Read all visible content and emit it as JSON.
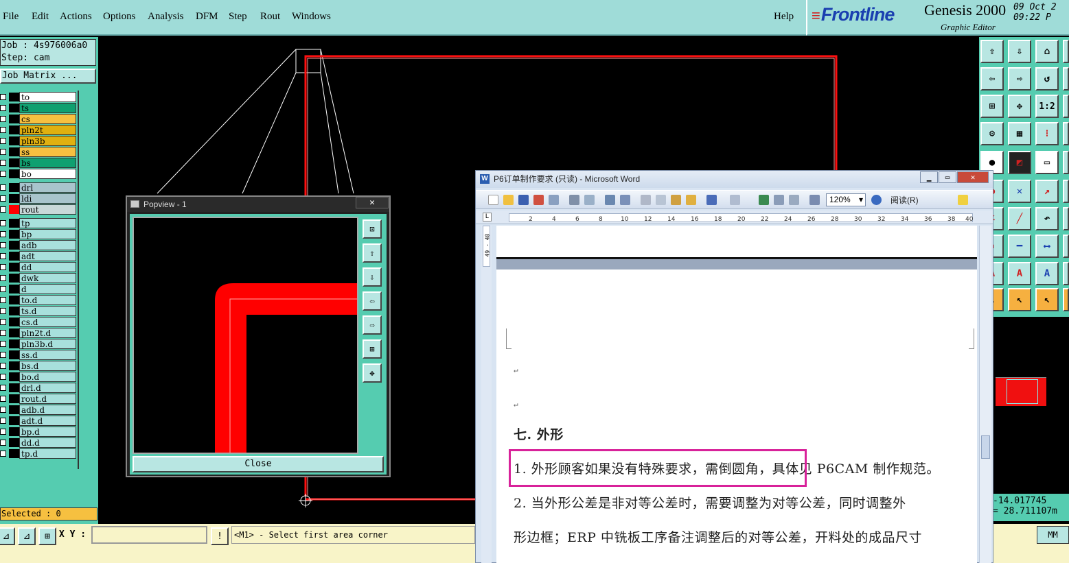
{
  "menubar": {
    "items": [
      "File",
      "Edit",
      "Actions",
      "Options",
      "Analysis",
      "DFM",
      "Step",
      "Rout",
      "Windows"
    ],
    "help": "Help"
  },
  "brand": {
    "logo": "Frontline",
    "product": "Genesis 2000",
    "subtitle": "Graphic Editor",
    "date": "09 Oct 2",
    "time": "09:22 P"
  },
  "left": {
    "job": "Job : 4s976006a0",
    "step": "Step: cam",
    "matrix_button": "Job Matrix ...",
    "selected": "Selected : 0",
    "layers": [
      {
        "name": "to",
        "color": "#ffffff",
        "swatch": "#000000"
      },
      {
        "name": "ts",
        "color": "#10a070",
        "swatch": "#000000"
      },
      {
        "name": "cs",
        "color": "#f6c040",
        "swatch": "#000000"
      },
      {
        "name": "pln2t",
        "color": "#e0b010",
        "swatch": "#000000"
      },
      {
        "name": "pln3b",
        "color": "#e0b010",
        "swatch": "#000000"
      },
      {
        "name": "ss",
        "color": "#f6c040",
        "swatch": "#000000"
      },
      {
        "name": "bs",
        "color": "#10a070",
        "swatch": "#000000"
      },
      {
        "name": "bo",
        "color": "#ffffff",
        "swatch": "#000000"
      },
      {
        "name": "drl",
        "color": "#a8c4cc",
        "swatch": "#000000"
      },
      {
        "name": "ldi",
        "color": "#a8c4cc",
        "swatch": "#000000"
      },
      {
        "name": "rout",
        "color": "#c8d8d8",
        "swatch": "#ff0000"
      },
      {
        "name": "tp",
        "color": "#a8e0dc",
        "swatch": "#000000"
      },
      {
        "name": "bp",
        "color": "#a8e0dc",
        "swatch": "#000000"
      },
      {
        "name": "adb",
        "color": "#a8e0dc",
        "swatch": "#000000"
      },
      {
        "name": "adt",
        "color": "#a8e0dc",
        "swatch": "#000000"
      },
      {
        "name": "dd",
        "color": "#a8e0dc",
        "swatch": "#000000"
      },
      {
        "name": "dwk",
        "color": "#a8e0dc",
        "swatch": "#000000"
      },
      {
        "name": "d",
        "color": "#a8e0dc",
        "swatch": "#000000"
      },
      {
        "name": "to.d",
        "color": "#a8e0dc",
        "swatch": "#000000"
      },
      {
        "name": "ts.d",
        "color": "#a8e0dc",
        "swatch": "#000000"
      },
      {
        "name": "cs.d",
        "color": "#a8e0dc",
        "swatch": "#000000"
      },
      {
        "name": "pln2t.d",
        "color": "#a8e0dc",
        "swatch": "#000000"
      },
      {
        "name": "pln3b.d",
        "color": "#a8e0dc",
        "swatch": "#000000"
      },
      {
        "name": "ss.d",
        "color": "#a8e0dc",
        "swatch": "#000000"
      },
      {
        "name": "bs.d",
        "color": "#a8e0dc",
        "swatch": "#000000"
      },
      {
        "name": "bo.d",
        "color": "#a8e0dc",
        "swatch": "#000000"
      },
      {
        "name": "drl.d",
        "color": "#a8e0dc",
        "swatch": "#000000"
      },
      {
        "name": "rout.d",
        "color": "#a8e0dc",
        "swatch": "#000000"
      },
      {
        "name": "adb.d",
        "color": "#a8e0dc",
        "swatch": "#000000"
      },
      {
        "name": "adt.d",
        "color": "#a8e0dc",
        "swatch": "#000000"
      },
      {
        "name": "bp.d",
        "color": "#a8e0dc",
        "swatch": "#000000"
      },
      {
        "name": "dd.d",
        "color": "#a8e0dc",
        "swatch": "#000000"
      },
      {
        "name": "tp.d",
        "color": "#a8e0dc",
        "swatch": "#000000"
      }
    ]
  },
  "right": {
    "x_readout": "-14.017745",
    "y_readout": "= 28.711107m",
    "unit": "MM"
  },
  "bottom": {
    "xy_label": "X Y :",
    "xy_value": "",
    "message": "<M1> - Select first area corner"
  },
  "popview": {
    "title": "Popview - 1",
    "close_x": "✕",
    "close_button": "Close"
  },
  "word": {
    "title": "P6订单制作要求 (只读) - Microsoft Word",
    "zoom": "120%",
    "read_mode": "阅读(R)",
    "ruler_side": "49 - 48",
    "heading": "七. 外形",
    "para1": "1. 外形顾客如果没有特殊要求，需倒圆角，具体见 P6CAM 制作规范。",
    "para2a": "2.  当外形公差是非对等公差时，需要调整为对等公差，同时调整外",
    "para2b": "形边框；ERP 中铣板工序备注调整后的对等公差，开料处的成品尺寸"
  },
  "colors": {
    "panel_teal": "#55ccb0",
    "button_face": "#b8e6e2",
    "rout_red": "#ff0000",
    "highlight_magenta": "#d8229a"
  }
}
